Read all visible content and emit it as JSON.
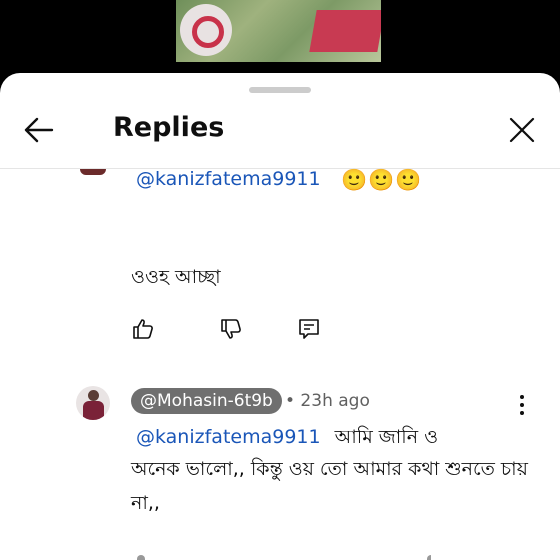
{
  "header": {
    "title": "Replies",
    "back_icon": "arrow-left-icon",
    "close_icon": "close-icon"
  },
  "comment1": {
    "mention": "@kanizfatema9911",
    "emojis": "🙂🙂🙂",
    "text": "ওওহ আচ্ছা",
    "actions": [
      "like-icon",
      "dislike-icon",
      "reply-icon"
    ]
  },
  "comment2": {
    "author": "@Mohasin-6t9b",
    "time": "• 23h ago",
    "mention": "@kanizfatema9911",
    "text_start": "আমি জানি ও",
    "text_rest": "অনেক ভালো,, কিন্তু ওয় তো আমার কথা শুনতে চায় না,,"
  },
  "colors": {
    "mention": "#1a56b8",
    "author_chip": "#6f6f6f"
  }
}
